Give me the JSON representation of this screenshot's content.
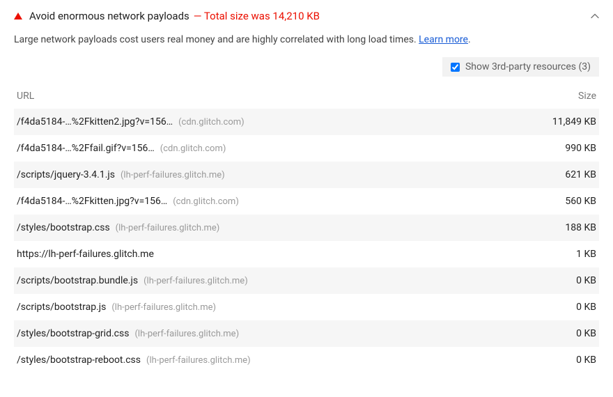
{
  "audit": {
    "title": "Avoid enormous network payloads",
    "displayText": "— Total size was 14,210 KB",
    "description": "Large network payloads cost users real money and are highly correlated with long load times. ",
    "learnMore": "Learn more"
  },
  "thirdParty": {
    "label": "Show 3rd-party resources (3)"
  },
  "table": {
    "headers": {
      "url": "URL",
      "size": "Size"
    },
    "rows": [
      {
        "path": "/f4da5184-…%2Fkitten2.jpg?v=156…",
        "host": "(cdn.glitch.com)",
        "size": "11,849 KB"
      },
      {
        "path": "/f4da5184-…%2Ffail.gif?v=156…",
        "host": "(cdn.glitch.com)",
        "size": "990 KB"
      },
      {
        "path": "/scripts/jquery-3.4.1.js",
        "host": "(lh-perf-failures.glitch.me)",
        "size": "621 KB"
      },
      {
        "path": "/f4da5184-…%2Fkitten.jpg?v=156…",
        "host": "(cdn.glitch.com)",
        "size": "560 KB"
      },
      {
        "path": "/styles/bootstrap.css",
        "host": "(lh-perf-failures.glitch.me)",
        "size": "188 KB"
      },
      {
        "path": "https://lh-perf-failures.glitch.me",
        "host": "",
        "size": "1 KB"
      },
      {
        "path": "/scripts/bootstrap.bundle.js",
        "host": "(lh-perf-failures.glitch.me)",
        "size": "0 KB"
      },
      {
        "path": "/scripts/bootstrap.js",
        "host": "(lh-perf-failures.glitch.me)",
        "size": "0 KB"
      },
      {
        "path": "/styles/bootstrap-grid.css",
        "host": "(lh-perf-failures.glitch.me)",
        "size": "0 KB"
      },
      {
        "path": "/styles/bootstrap-reboot.css",
        "host": "(lh-perf-failures.glitch.me)",
        "size": "0 KB"
      }
    ]
  }
}
